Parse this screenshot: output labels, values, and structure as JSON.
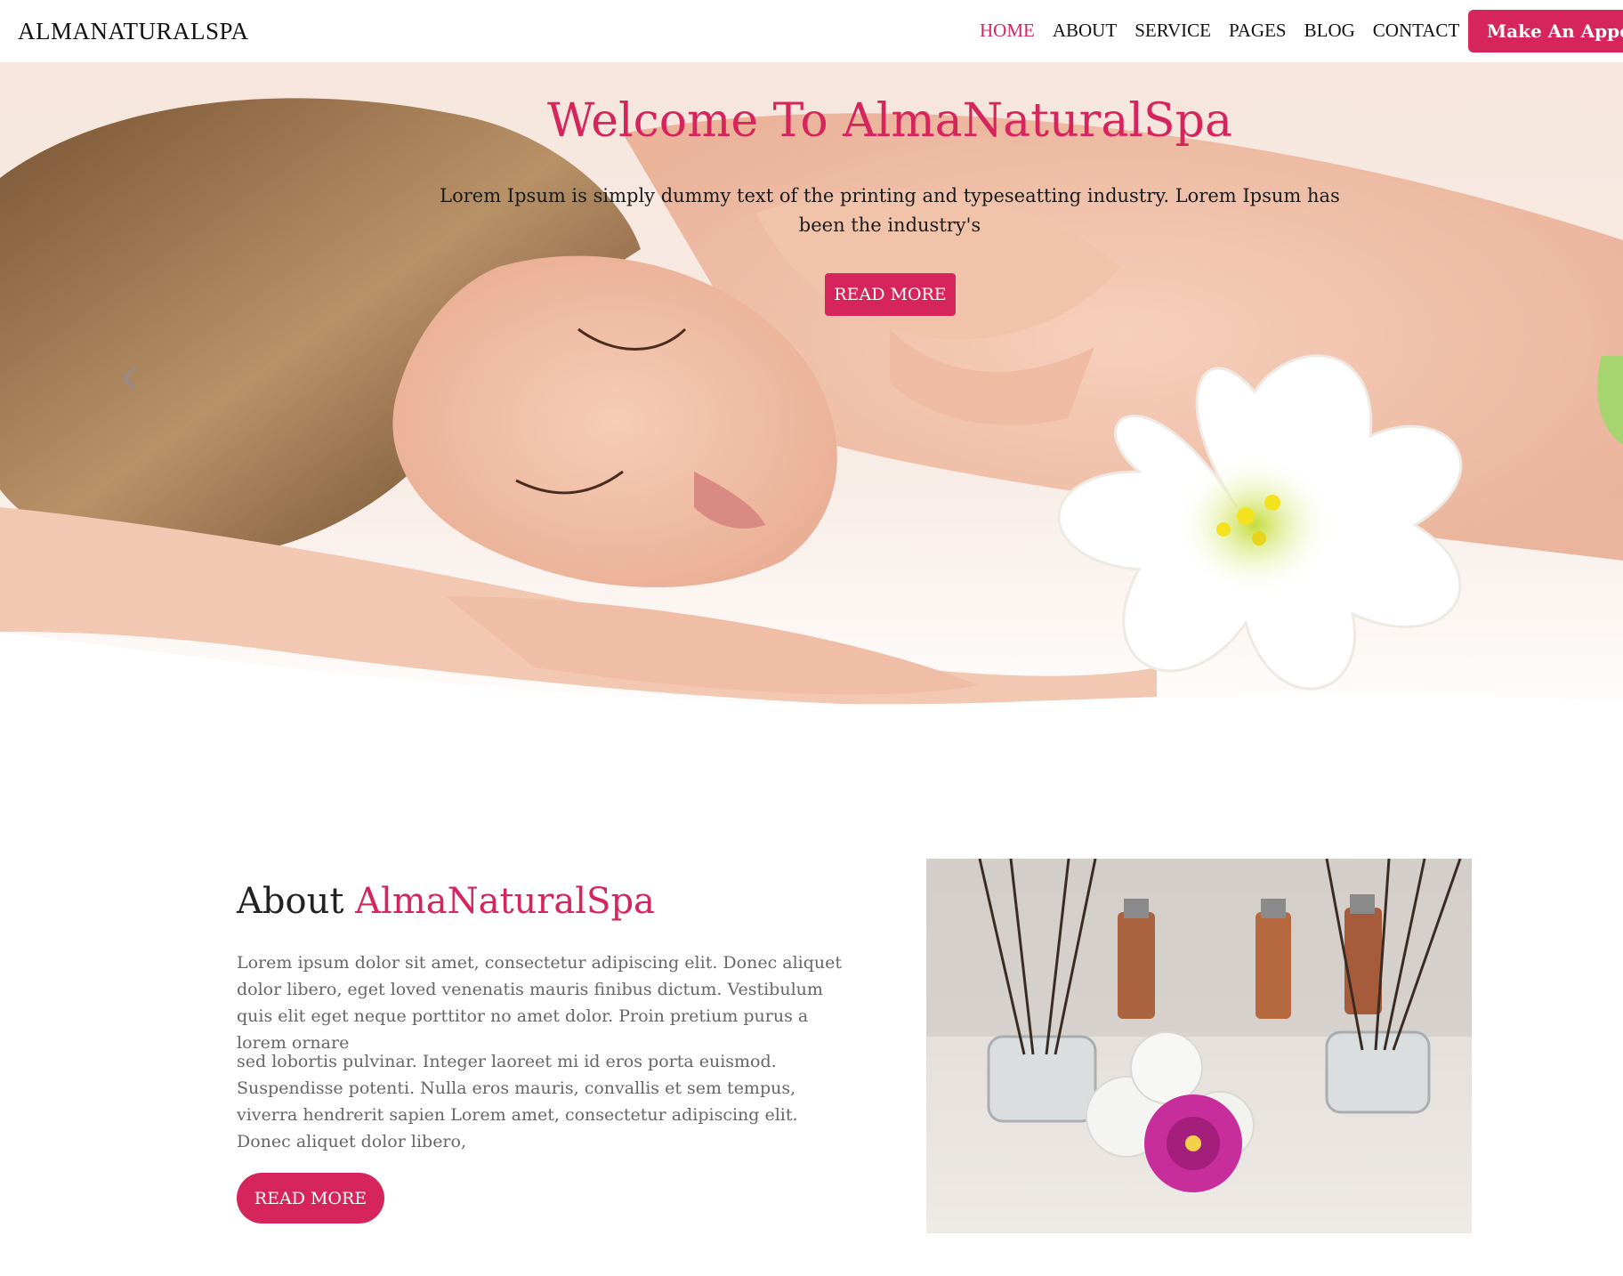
{
  "brand": {
    "name": "ALMANATURALSPA"
  },
  "nav": {
    "items": [
      {
        "label": "HOME",
        "active": true
      },
      {
        "label": "ABOUT",
        "active": false
      },
      {
        "label": "SERVICE",
        "active": false
      },
      {
        "label": "PAGES",
        "active": false
      },
      {
        "label": "BLOG",
        "active": false
      },
      {
        "label": "CONTACT",
        "active": false
      }
    ],
    "cta_label": "Make An Appointment",
    "cta_icon": "calendar-check-icon"
  },
  "hero": {
    "title": "Welcome To AlmaNaturalSpa",
    "subtitle": "Lorem Ipsum is simply dummy text of the printing and typeseatting industry. Lorem Ipsum has been the industry's",
    "button_label": "READ MORE",
    "prev_icon": "chevron-left-icon"
  },
  "about": {
    "title_plain": "About",
    "title_accent": "AlmaNaturalSpa",
    "paragraph1": "Lorem ipsum dolor sit amet, consectetur adipiscing elit. Donec aliquet dolor libero, eget loved venenatis mauris finibus dictum. Vestibulum quis elit eget neque porttitor no amet dolor. Proin pretium purus a lorem ornare",
    "paragraph2": "sed lobortis pulvinar. Integer laoreet mi id eros porta euismod. Suspendisse potenti. Nulla eros mauris, convallis et sem tempus, viverra hendrerit sapien Lorem amet, consectetur adipiscing elit. Donec aliquet dolor libero,",
    "button_label": "READ MORE"
  },
  "colors": {
    "accent": "#d6245c",
    "text": "#222222",
    "muted": "#666666"
  }
}
